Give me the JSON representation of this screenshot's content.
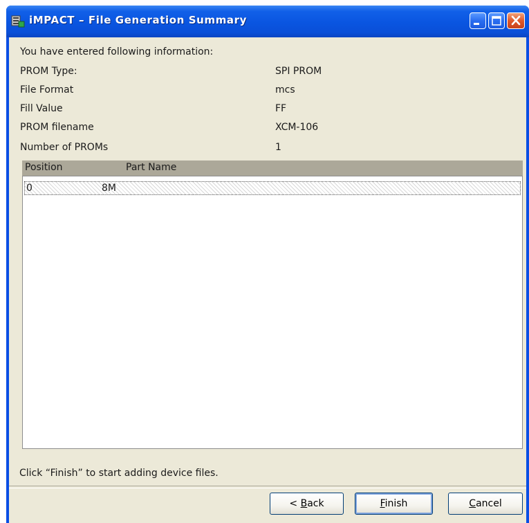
{
  "window": {
    "title": "iMPACT – File Generation Summary",
    "title_icon": "impact-app-icon",
    "controls": [
      "minimize-icon",
      "maximize-icon",
      "close-icon"
    ]
  },
  "summary": {
    "intro": "You have entered following information:",
    "fields": [
      {
        "label": "PROM Type:",
        "value": "SPI PROM"
      },
      {
        "label": "File Format",
        "value": "mcs"
      },
      {
        "label": "Fill Value",
        "value": "FF"
      },
      {
        "label": "PROM filename",
        "value": "XCM-106"
      },
      {
        "label": "Number of PROMs",
        "value": "1"
      }
    ]
  },
  "table": {
    "headers": [
      "Position",
      "Part Name"
    ],
    "rows": [
      {
        "position": "0",
        "part_name": "8M"
      }
    ]
  },
  "hint": "Click “Finish” to start adding device files.",
  "buttons": {
    "back": {
      "prefix": "< ",
      "mnemonic": "B",
      "rest": "ack"
    },
    "finish": {
      "prefix": "",
      "mnemonic": "F",
      "rest": "inish"
    },
    "cancel": {
      "prefix": "",
      "mnemonic": "C",
      "rest": "ancel"
    }
  },
  "colors": {
    "titlebar": "#0a55e0",
    "client": "#ece9d8",
    "table_header": "#aca899",
    "close_button": "#e0582a"
  }
}
